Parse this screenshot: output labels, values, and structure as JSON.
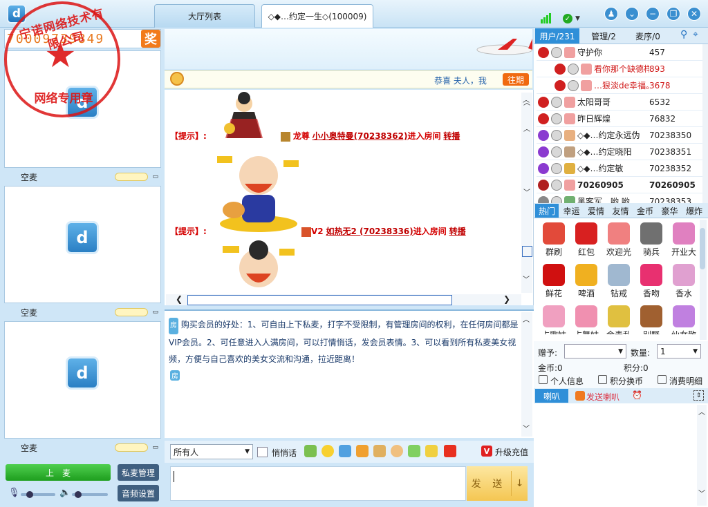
{
  "tabs": {
    "hall": "大厅列表",
    "room": "◇◆…约定一生◇(100009)"
  },
  "stamp": {
    "text": "宁诺网络技术有限公司",
    "sub": "网络专用章"
  },
  "id_number": "70009739849",
  "award": "奖",
  "mic_slots": [
    "空麦",
    "空麦",
    "空麦"
  ],
  "left_controls": {
    "on_mic": "上　麦",
    "private_mic": "私麦管理",
    "audio": "音频设置"
  },
  "congrats": {
    "text": "恭喜 夫人，我",
    "past": "往期"
  },
  "messages": [
    {
      "hint": "【提示】:",
      "prefix": "龙尊",
      "user": "小小奥特曼(70238362)",
      "action": "进入房间",
      "link": "转播"
    },
    {
      "hint": "【提示】:",
      "prefix": "V2",
      "user": "如热无2 (70238336)",
      "action": "进入房间",
      "link": "转播"
    }
  ],
  "notice": "购买会员的好处：1、可自由上下私麦，打字不受限制，有管理房间的权利，在任何房间都是VIP会员。2、可任意进入人满房间，可以打情悄话，发会员表情。3、可以看到所有私麦美女视频，方便与自己喜欢的美女交流和沟通，拉近距离！",
  "notice_tag": "房",
  "input_bar": {
    "target": "所有人",
    "whisper": "悄悄话",
    "upgrade": "升级充值",
    "send": "发 送"
  },
  "user_tabs": {
    "users": "用户/231",
    "admins": "管理/2",
    "mic": "麦序/0"
  },
  "users": [
    {
      "name": "守护你",
      "id": "457",
      "red": false
    },
    {
      "name": "看你那个缺德样",
      "id": "893",
      "red": true
    },
    {
      "name": "…狠淡de幸福。",
      "id": "3678",
      "red": true
    },
    {
      "name": "太阳哥哥",
      "id": "6532",
      "red": false
    },
    {
      "name": "昨日辉煌",
      "id": "76832",
      "red": false
    },
    {
      "name": "◇◆…约定永远伪",
      "id": "70238350",
      "red": false
    },
    {
      "name": "◇◆…约定晓阳",
      "id": "70238351",
      "red": false
    },
    {
      "name": "◇◆…约定敏",
      "id": "70238352",
      "red": false
    },
    {
      "name": "70260905",
      "id": "70260905",
      "red": false
    },
    {
      "name": "黑客军…哟 哟",
      "id": "70238353",
      "red": false
    }
  ],
  "gift_tabs": [
    "热门",
    "幸运",
    "爱情",
    "友情",
    "金币",
    "豪华",
    "爆炸"
  ],
  "gifts": [
    {
      "name": "群刷",
      "icon": "group-brush-icon",
      "color": "#e24a3a"
    },
    {
      "name": "红包",
      "icon": "red-envelope-icon",
      "color": "#d82020"
    },
    {
      "name": "欢迎光",
      "icon": "welcome-icon",
      "color": "#f08080"
    },
    {
      "name": "骑兵",
      "icon": "cavalry-icon",
      "color": "#707070"
    },
    {
      "name": "开业大",
      "icon": "opening-icon",
      "color": "#e080c0"
    },
    {
      "name": "鲜花",
      "icon": "rose-icon",
      "color": "#d01010"
    },
    {
      "name": "啤酒",
      "icon": "beer-icon",
      "color": "#f0b020"
    },
    {
      "name": "钻戒",
      "icon": "ring-icon",
      "color": "#a0b8d0"
    },
    {
      "name": "香吻",
      "icon": "kiss-icon",
      "color": "#e83070"
    },
    {
      "name": "香水",
      "icon": "perfume-icon",
      "color": "#e0a0d0"
    },
    {
      "name": "占歌姑",
      "icon": "girl-icon",
      "color": "#f0a0c0"
    },
    {
      "name": "占舞姑",
      "icon": "dancer-icon",
      "color": "#f090b0"
    },
    {
      "name": "金毒乱",
      "icon": "gold-icon",
      "color": "#e0c040"
    },
    {
      "name": "别野",
      "icon": "villa-icon",
      "color": "#a06030"
    },
    {
      "name": "仙女散",
      "icon": "fairy-icon",
      "color": "#c080e0"
    }
  ],
  "give": {
    "to": "赠予:",
    "qty": "数量:",
    "qty_value": "1",
    "coins": "金币:0",
    "points": "积分:0"
  },
  "actions": {
    "info": "个人信息",
    "exchange": "积分换币",
    "detail": "消费明细"
  },
  "horn": {
    "tab": "喇叭",
    "send": "发送喇叭"
  }
}
